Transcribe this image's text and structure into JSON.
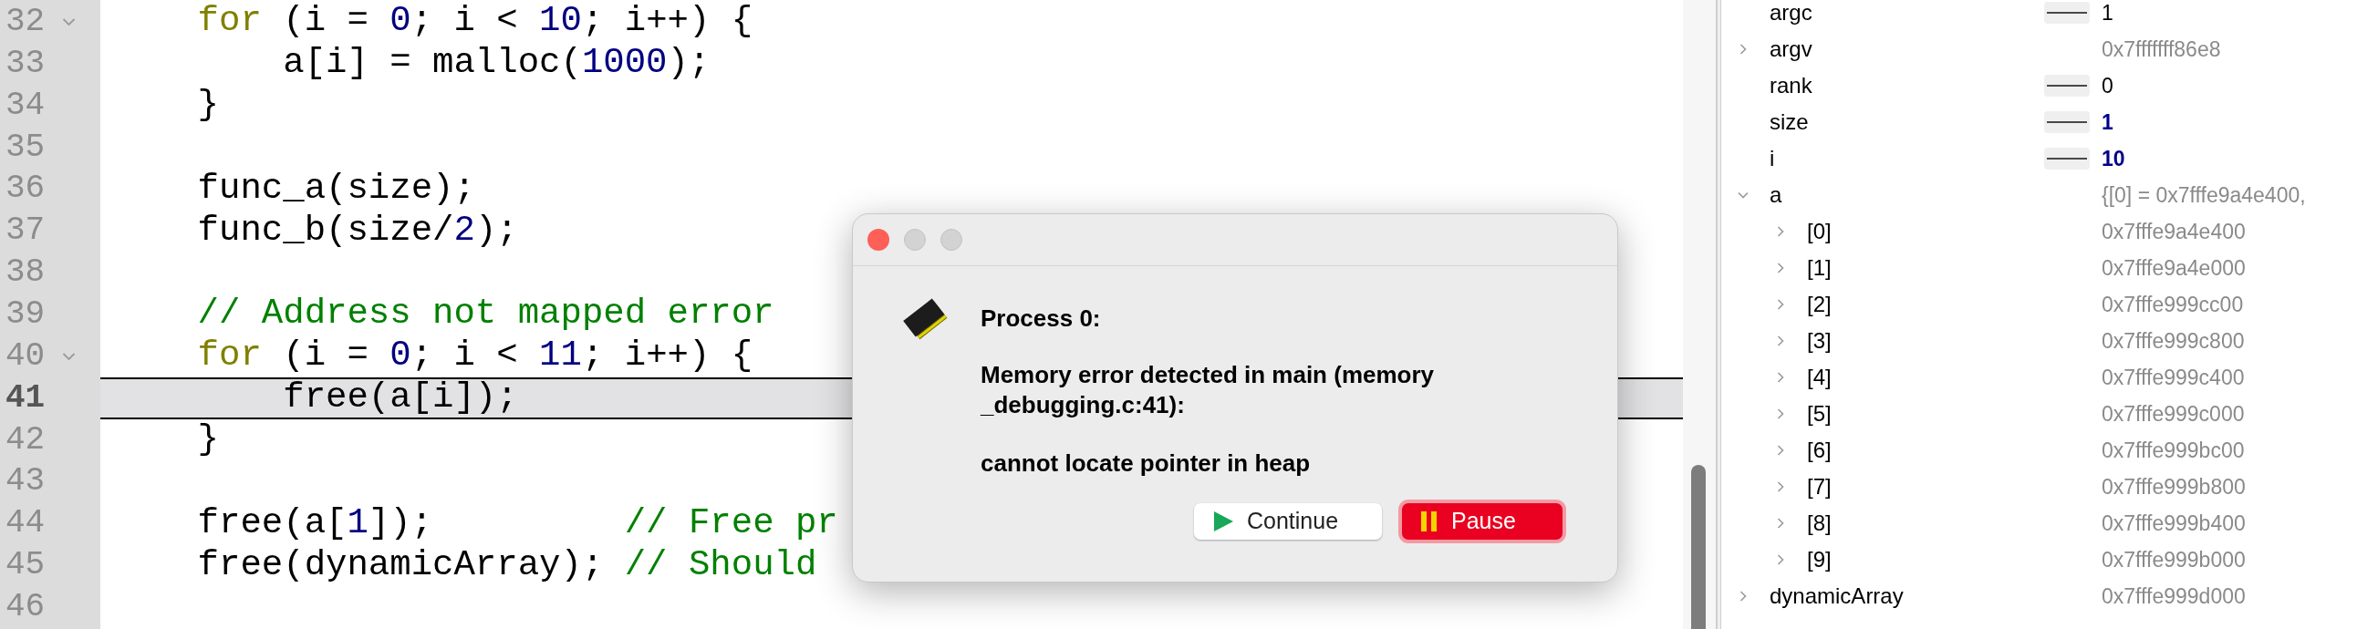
{
  "editor": {
    "lines": [
      {
        "number": "32",
        "fold": true,
        "current": false,
        "tokens": [
          {
            "text": "    for",
            "kind": "keyword"
          },
          {
            "text": " (i = ",
            "kind": "plain"
          },
          {
            "text": "0",
            "kind": "number"
          },
          {
            "text": "; i < ",
            "kind": "plain"
          },
          {
            "text": "10",
            "kind": "number"
          },
          {
            "text": "; i++) {",
            "kind": "plain"
          }
        ]
      },
      {
        "number": "33",
        "fold": false,
        "current": false,
        "tokens": [
          {
            "text": "        a[i] = malloc(",
            "kind": "plain"
          },
          {
            "text": "1000",
            "kind": "number"
          },
          {
            "text": ");",
            "kind": "plain"
          }
        ]
      },
      {
        "number": "34",
        "fold": false,
        "current": false,
        "tokens": [
          {
            "text": "    }",
            "kind": "plain"
          }
        ]
      },
      {
        "number": "35",
        "fold": false,
        "current": false
      },
      {
        "number": "36",
        "fold": false,
        "current": false,
        "tokens": [
          {
            "text": "    func_a(size);",
            "kind": "plain"
          }
        ]
      },
      {
        "number": "37",
        "fold": false,
        "current": false,
        "tokens": [
          {
            "text": "    func_b(size/",
            "kind": "plain"
          },
          {
            "text": "2",
            "kind": "number"
          },
          {
            "text": ");",
            "kind": "plain"
          }
        ]
      },
      {
        "number": "38",
        "fold": false,
        "current": false
      },
      {
        "number": "39",
        "fold": false,
        "current": false,
        "tokens": [
          {
            "text": "    // Address not mapped error",
            "kind": "comment"
          }
        ]
      },
      {
        "number": "40",
        "fold": true,
        "current": false,
        "tokens": [
          {
            "text": "    for",
            "kind": "keyword"
          },
          {
            "text": " (i = ",
            "kind": "plain"
          },
          {
            "text": "0",
            "kind": "number"
          },
          {
            "text": "; i < ",
            "kind": "plain"
          },
          {
            "text": "11",
            "kind": "number"
          },
          {
            "text": "; i++) {",
            "kind": "plain"
          }
        ]
      },
      {
        "number": "41",
        "fold": false,
        "current": true,
        "tokens": [
          {
            "text": "        free(a[i]);",
            "kind": "plain"
          }
        ]
      },
      {
        "number": "42",
        "fold": false,
        "current": false,
        "tokens": [
          {
            "text": "    }",
            "kind": "plain"
          }
        ]
      },
      {
        "number": "43",
        "fold": false,
        "current": false
      },
      {
        "number": "44",
        "fold": false,
        "current": false,
        "tokens": [
          {
            "text": "    free(a[",
            "kind": "plain"
          },
          {
            "text": "1",
            "kind": "number"
          },
          {
            "text": "]);         ",
            "kind": "plain"
          },
          {
            "text": "// Free pr",
            "kind": "comment"
          }
        ]
      },
      {
        "number": "45",
        "fold": false,
        "current": false,
        "tokens": [
          {
            "text": "    free(dynamicArray); ",
            "kind": "plain"
          },
          {
            "text": "// Should",
            "kind": "comment"
          }
        ]
      },
      {
        "number": "46",
        "fold": false,
        "current": false
      }
    ]
  },
  "variables": [
    {
      "name": "argc",
      "value": "1",
      "kind": "scalar",
      "changed": false
    },
    {
      "name": "argv",
      "value": "0x7fffffff86e8",
      "kind": "pointer",
      "expanded": false
    },
    {
      "name": "rank",
      "value": "0",
      "kind": "scalar",
      "changed": false
    },
    {
      "name": "size",
      "value": "1",
      "kind": "scalar",
      "changed": true
    },
    {
      "name": "i",
      "value": "10",
      "kind": "scalar",
      "changed": true
    },
    {
      "name": "a",
      "value": "{[0] = 0x7fffe9a4e400,",
      "kind": "pointer",
      "expanded": true,
      "children": [
        {
          "name": "[0]",
          "value": "0x7fffe9a4e400",
          "kind": "pointer",
          "expanded": false
        },
        {
          "name": "[1]",
          "value": "0x7fffe9a4e000",
          "kind": "pointer",
          "expanded": false
        },
        {
          "name": "[2]",
          "value": "0x7fffe999cc00",
          "kind": "pointer",
          "expanded": false
        },
        {
          "name": "[3]",
          "value": "0x7fffe999c800",
          "kind": "pointer",
          "expanded": false
        },
        {
          "name": "[4]",
          "value": "0x7fffe999c400",
          "kind": "pointer",
          "expanded": false
        },
        {
          "name": "[5]",
          "value": "0x7fffe999c000",
          "kind": "pointer",
          "expanded": false
        },
        {
          "name": "[6]",
          "value": "0x7fffe999bc00",
          "kind": "pointer",
          "expanded": false
        },
        {
          "name": "[7]",
          "value": "0x7fffe999b800",
          "kind": "pointer",
          "expanded": false
        },
        {
          "name": "[8]",
          "value": "0x7fffe999b400",
          "kind": "pointer",
          "expanded": false
        },
        {
          "name": "[9]",
          "value": "0x7fffe999b000",
          "kind": "pointer",
          "expanded": false
        }
      ]
    },
    {
      "name": "dynamicArray",
      "value": "0x7fffe999d000",
      "kind": "pointer",
      "expanded": false
    }
  ],
  "dialog": {
    "heading": "Process 0:",
    "message": "Memory error detected in main (memory_debugging.c:41):",
    "detail": "cannot locate pointer in heap",
    "buttons": [
      {
        "label": "Continue",
        "kind": "play",
        "default": false
      },
      {
        "label": "Pause",
        "kind": "pause",
        "default": true
      }
    ]
  }
}
